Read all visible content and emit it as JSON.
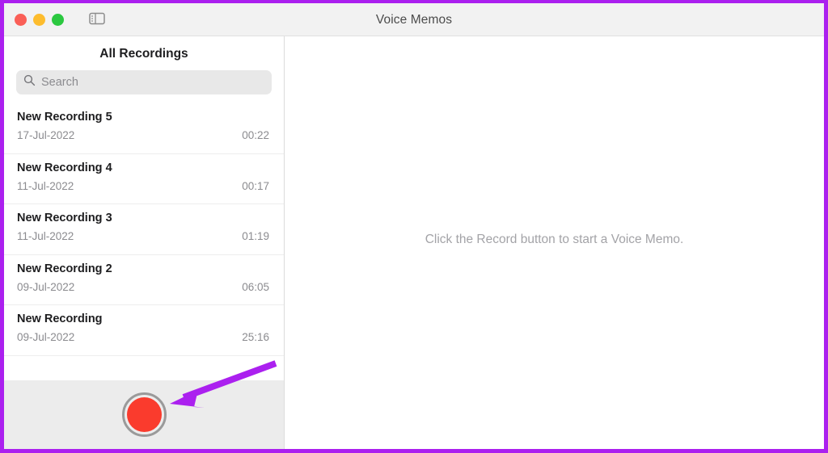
{
  "window": {
    "title": "Voice Memos",
    "traffic_lights": [
      {
        "name": "close",
        "color": "#fa5f57"
      },
      {
        "name": "minimize",
        "color": "#fdbc2d"
      },
      {
        "name": "zoom",
        "color": "#2bc840"
      }
    ],
    "toolbar": {
      "sidebar_toggle_icon": "sidebar-toggle-icon"
    }
  },
  "sidebar": {
    "header": "All Recordings",
    "search": {
      "icon": "search-icon",
      "placeholder": "Search",
      "value": ""
    },
    "recordings": [
      {
        "title": "New Recording 5",
        "date": "17-Jul-2022",
        "duration": "00:22"
      },
      {
        "title": "New Recording 4",
        "date": "11-Jul-2022",
        "duration": "00:17"
      },
      {
        "title": "New Recording 3",
        "date": "11-Jul-2022",
        "duration": "01:19"
      },
      {
        "title": "New Recording 2",
        "date": "09-Jul-2022",
        "duration": "06:05"
      },
      {
        "title": "New Recording",
        "date": "09-Jul-2022",
        "duration": "25:16"
      }
    ],
    "record_button": {
      "icon": "record-icon",
      "color": "#fa3b2d"
    }
  },
  "main": {
    "empty_state_message": "Click the Record button to start a Voice Memo."
  },
  "annotation": {
    "arrow_color": "#ab20ef",
    "border_color": "#ab20ef"
  }
}
